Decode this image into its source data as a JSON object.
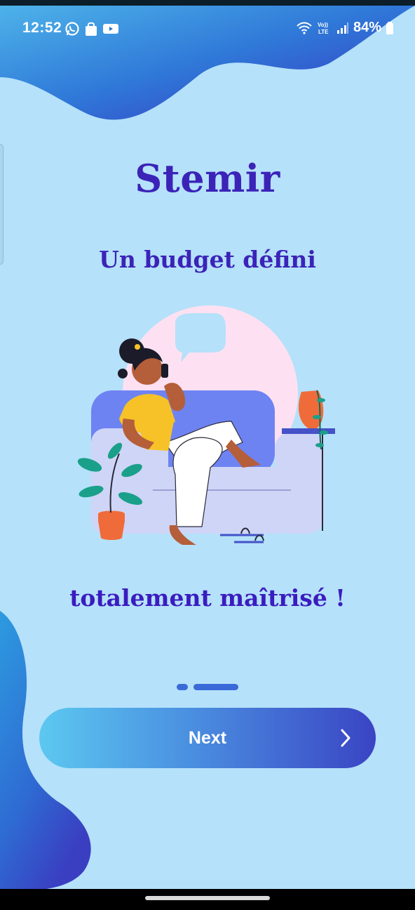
{
  "status_bar": {
    "time": "12:52",
    "battery": "84%",
    "left_icons": [
      "whatsapp-icon",
      "shopping-bag-icon",
      "youtube-icon"
    ],
    "right_icons": [
      "wifi-icon",
      "volte-icon",
      "signal-icon",
      "battery-icon"
    ],
    "volte_label": "Vo)) LTE"
  },
  "onboarding": {
    "title": "Stemir",
    "subtitle": "Un budget défini",
    "caption": "totalement maîtrisé !",
    "page_count": 2,
    "active_page": 2
  },
  "actions": {
    "next_label": "Next",
    "next_icon": "chevron-right-icon"
  },
  "colors": {
    "background": "#b5e1fa",
    "title": "#3b23b8",
    "button_gradient_start": "#5cc8f0",
    "button_gradient_end": "#3a44c4"
  }
}
